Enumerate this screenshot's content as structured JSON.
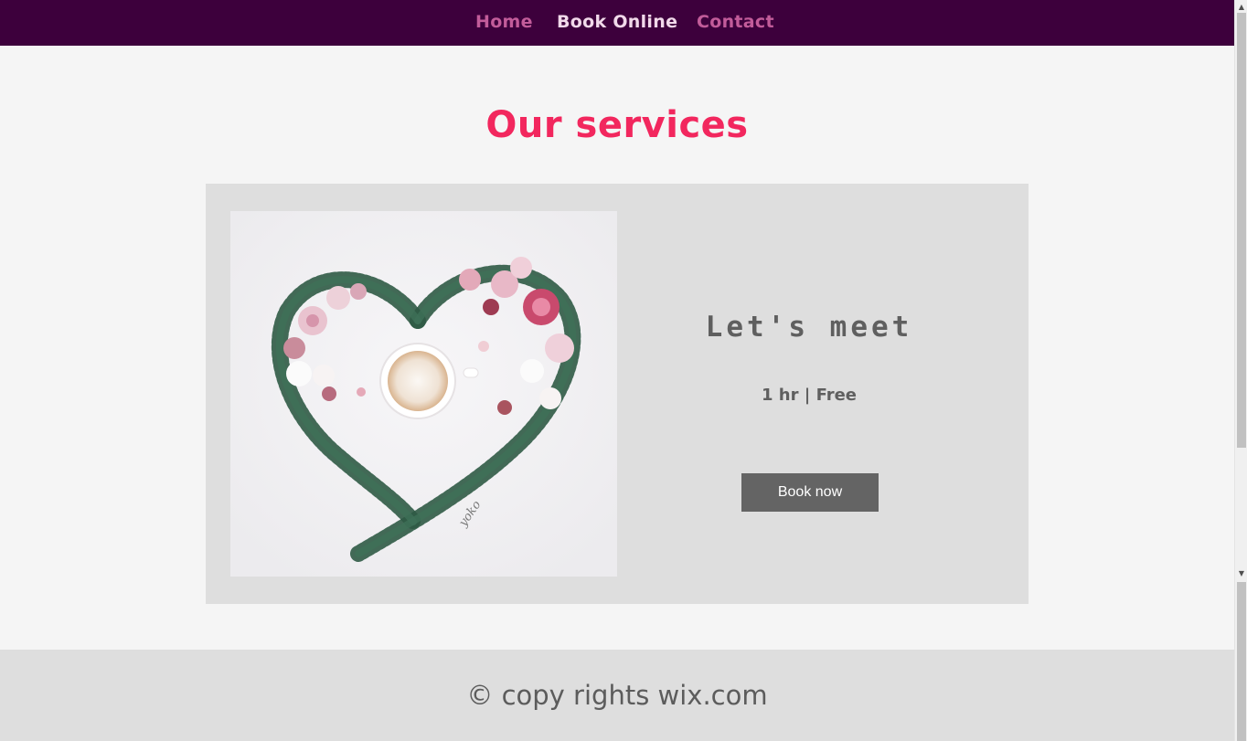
{
  "nav": {
    "items": [
      {
        "label": "Home"
      },
      {
        "label": "Book Online"
      },
      {
        "label": "Contact"
      }
    ]
  },
  "main": {
    "title": "Our services",
    "service": {
      "name": "Let's meet",
      "meta": "1 hr | Free",
      "button_label": "Book now",
      "image_signature": "yoko"
    }
  },
  "footer": {
    "text": "© copy rights wix.com"
  },
  "colors": {
    "nav_bg": "#3d003c",
    "accent": "#f2275e",
    "nav_link": "#c25c9a",
    "nav_active": "#f1d9ea",
    "card_bg": "#dedede",
    "button_bg": "#646464"
  }
}
